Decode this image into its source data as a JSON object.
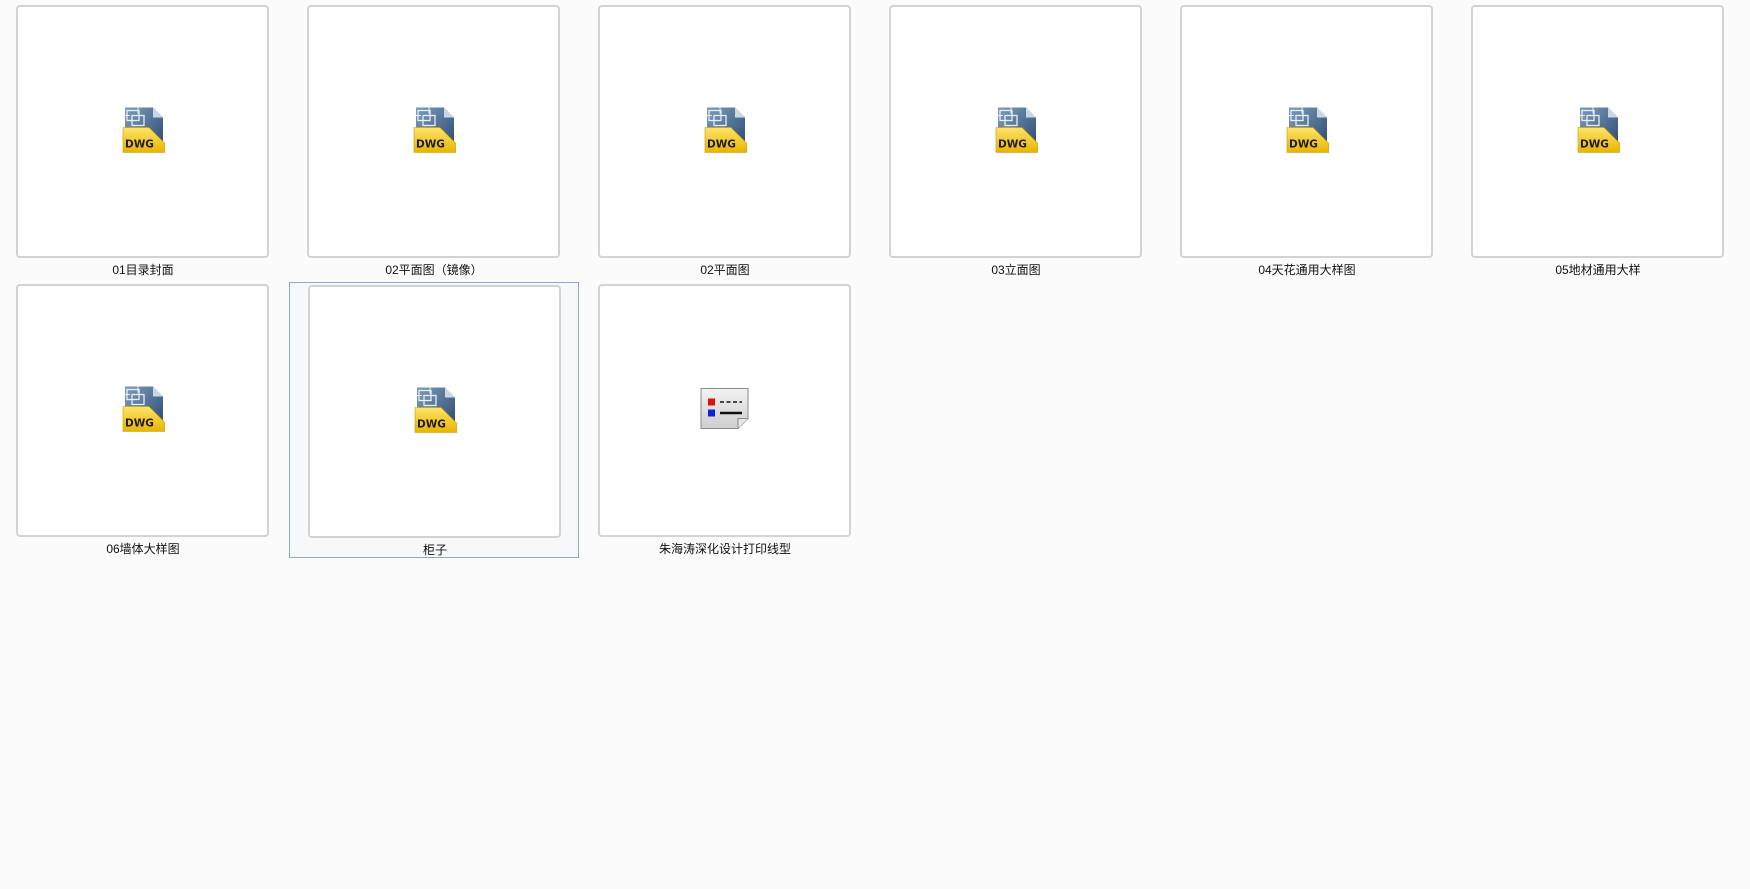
{
  "files": [
    {
      "name": "01目录封面",
      "icon": "dwg-file-icon",
      "selected": false
    },
    {
      "name": "02平面图（镜像）",
      "icon": "dwg-file-icon",
      "selected": false
    },
    {
      "name": "02平面图",
      "icon": "dwg-file-icon",
      "selected": false
    },
    {
      "name": "03立面图",
      "icon": "dwg-file-icon",
      "selected": false
    },
    {
      "name": "04天花通用大样图",
      "icon": "dwg-file-icon",
      "selected": false
    },
    {
      "name": "05地材通用大样",
      "icon": "dwg-file-icon",
      "selected": false
    },
    {
      "name": "06墙体大样图",
      "icon": "dwg-file-icon",
      "selected": false
    },
    {
      "name": "柜子",
      "icon": "dwg-file-icon",
      "selected": true
    },
    {
      "name": "朱海涛深化设计打印线型",
      "icon": "linetype-file-icon",
      "selected": false
    }
  ],
  "icon_badge_text": "DWG",
  "colors": {
    "dwg_yellow": "#f3c414",
    "dwg_blue": "#3c5f86",
    "selection_border": "#8fa7c9"
  }
}
